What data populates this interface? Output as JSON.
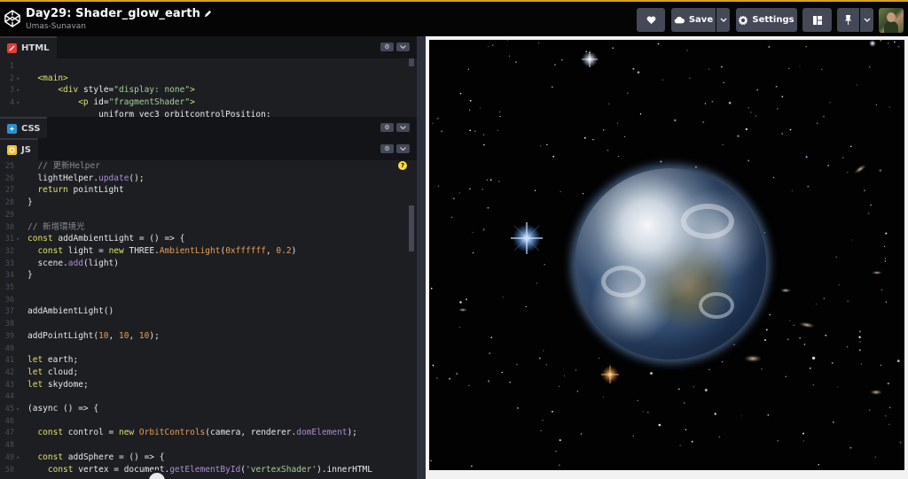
{
  "header": {
    "title": "Day29: Shader_glow_earth",
    "author": "Umas-Sunavan",
    "save_label": "Save",
    "settings_label": "Settings"
  },
  "panes": {
    "html": {
      "label": "HTML",
      "badge_color": "#e23d37",
      "lines": [
        {
          "n": "1",
          "fold": "",
          "html": ""
        },
        {
          "n": "2",
          "fold": "▾",
          "html": "  <span class='t-tag'>&lt;main&gt;</span>"
        },
        {
          "n": "3",
          "fold": "▾",
          "html": "      <span class='t-tag'>&lt;div</span> <span class='t-attr'>style=</span><span class='t-attrv'>\"display: none\"</span><span class='t-tag'>&gt;</span>"
        },
        {
          "n": "4",
          "fold": "▾",
          "html": "          <span class='t-tag'>&lt;p</span> <span class='t-attr'>id=</span><span class='t-attrv'>\"fragmentShader\"</span><span class='t-tag'>&gt;</span>"
        },
        {
          "n": "",
          "fold": "",
          "html": "              <span class='t-plain'>uniform vec3 orbitcontrolPosition:</span>"
        }
      ]
    },
    "css": {
      "label": "CSS",
      "badge_color": "#2b8fd6"
    },
    "js": {
      "label": "JS",
      "badge_color": "#f4c430",
      "lines": [
        {
          "n": "25",
          "fold": "",
          "html": "  <span class='t-cm'>// 更新Helper</span>"
        },
        {
          "n": "26",
          "fold": "",
          "html": "  <span class='t-plain'>lightHelper.</span><span class='t-fn2'>update</span><span class='t-plain'>();</span>"
        },
        {
          "n": "27",
          "fold": "",
          "html": "  <span class='t-kw'>return</span> <span class='t-plain'>pointLight</span>"
        },
        {
          "n": "28",
          "fold": "",
          "html": "<span class='t-plain'>}</span>"
        },
        {
          "n": "29",
          "fold": "",
          "html": ""
        },
        {
          "n": "30",
          "fold": "",
          "html": "<span class='t-cm'>// 新增環境光</span>"
        },
        {
          "n": "31",
          "fold": "▾",
          "html": "<span class='t-kw'>const</span> <span class='t-plain'>addAmbientLight = () =&gt; {</span>"
        },
        {
          "n": "32",
          "fold": "",
          "html": "  <span class='t-kw'>const</span> <span class='t-plain'>light =</span> <span class='t-kw'>new</span> <span class='t-plain'>THREE.</span><span class='t-cls'>AmbientLight</span><span class='t-plain'>(</span><span class='t-num'>0xffffff</span><span class='t-plain'>,</span> <span class='t-num'>0.2</span><span class='t-plain'>)</span>"
        },
        {
          "n": "33",
          "fold": "",
          "html": "  <span class='t-plain'>scene.</span><span class='t-fn2'>add</span><span class='t-plain'>(light)</span>"
        },
        {
          "n": "34",
          "fold": "",
          "html": "<span class='t-plain'>}</span>"
        },
        {
          "n": "35",
          "fold": "",
          "html": ""
        },
        {
          "n": "36",
          "fold": "",
          "html": ""
        },
        {
          "n": "37",
          "fold": "",
          "html": "<span class='t-plain'>addAmbientLight()</span>"
        },
        {
          "n": "38",
          "fold": "",
          "html": ""
        },
        {
          "n": "39",
          "fold": "",
          "html": "<span class='t-plain'>addPointLight(</span><span class='t-num'>10</span><span class='t-plain'>,</span> <span class='t-num'>10</span><span class='t-plain'>,</span> <span class='t-num'>10</span><span class='t-plain'>);</span>"
        },
        {
          "n": "40",
          "fold": "",
          "html": ""
        },
        {
          "n": "41",
          "fold": "",
          "html": "<span class='t-kw'>let</span> <span class='t-plain'>earth;</span>"
        },
        {
          "n": "42",
          "fold": "",
          "html": "<span class='t-kw'>let</span> <span class='t-plain'>cloud;</span>"
        },
        {
          "n": "43",
          "fold": "",
          "html": "<span class='t-kw'>let</span> <span class='t-plain'>skydome;</span>"
        },
        {
          "n": "44",
          "fold": "",
          "html": ""
        },
        {
          "n": "45",
          "fold": "▾",
          "html": "<span class='t-plain'>(async () =&gt; {</span>"
        },
        {
          "n": "46",
          "fold": "",
          "html": ""
        },
        {
          "n": "47",
          "fold": "",
          "html": "  <span class='t-kw'>const</span> <span class='t-plain'>control =</span> <span class='t-kw'>new</span> <span class='t-cls'>OrbitControls</span><span class='t-plain'>(camera, renderer.</span><span class='t-fn2'>domElement</span><span class='t-plain'>);</span>"
        },
        {
          "n": "48",
          "fold": "",
          "html": ""
        },
        {
          "n": "49",
          "fold": "▾",
          "html": "  <span class='t-kw'>const</span> <span class='t-plain'>addSphere = () =&gt; {</span>"
        },
        {
          "n": "50",
          "fold": "",
          "html": "    <span class='t-kw'>const</span> <span class='t-plain'>vertex = document.</span><span class='t-fn2'>getElementById</span><span class='t-plain'>(</span><span class='t-str'>'vertexShader'</span><span class='t-plain'>).innerHTML</span>"
        }
      ]
    }
  },
  "colors": {
    "accent": "#d4a41a",
    "button_bg": "#444857",
    "editor_bg": "#1d1e22"
  }
}
